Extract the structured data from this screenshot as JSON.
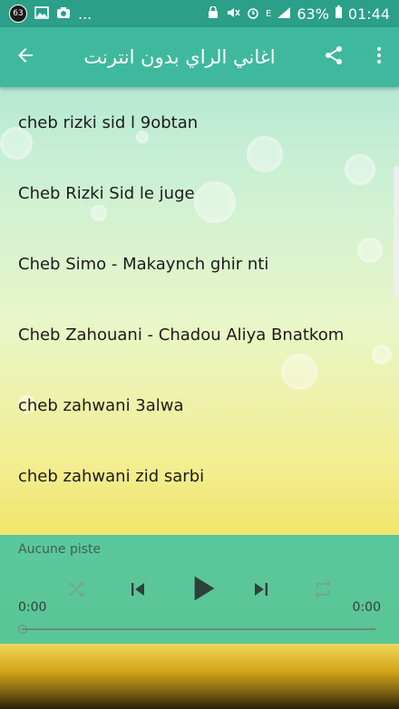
{
  "status_bar": {
    "notification_count": "63",
    "more_indicator": "...",
    "network_label": "E",
    "battery": "63%",
    "time": "01:44"
  },
  "app_bar": {
    "title": "اغاني الراي بدون انترنت",
    "back_icon": "arrow-back-icon",
    "share_icon": "share-icon",
    "menu_icon": "more-vert-icon"
  },
  "songs": [
    "cheb rizki sid l 9obtan",
    "Cheb Rizki Sid le juge",
    "Cheb Simo - Makaynch ghir nti",
    "Cheb Zahouani - Chadou Aliya Bnatkom",
    "cheb zahwani 3alwa",
    "cheb zahwani zid sarbi"
  ],
  "player": {
    "track_label": "Aucune piste",
    "elapsed": "0:00",
    "duration": "0:00",
    "progress": 0,
    "colors": {
      "bar": "#46c3a3",
      "active_icon": "#2f3f3b",
      "inactive_icon": "#6fa79a"
    }
  },
  "colors": {
    "status_bar": "#2b9f88",
    "app_bar": "#3fb99d"
  }
}
